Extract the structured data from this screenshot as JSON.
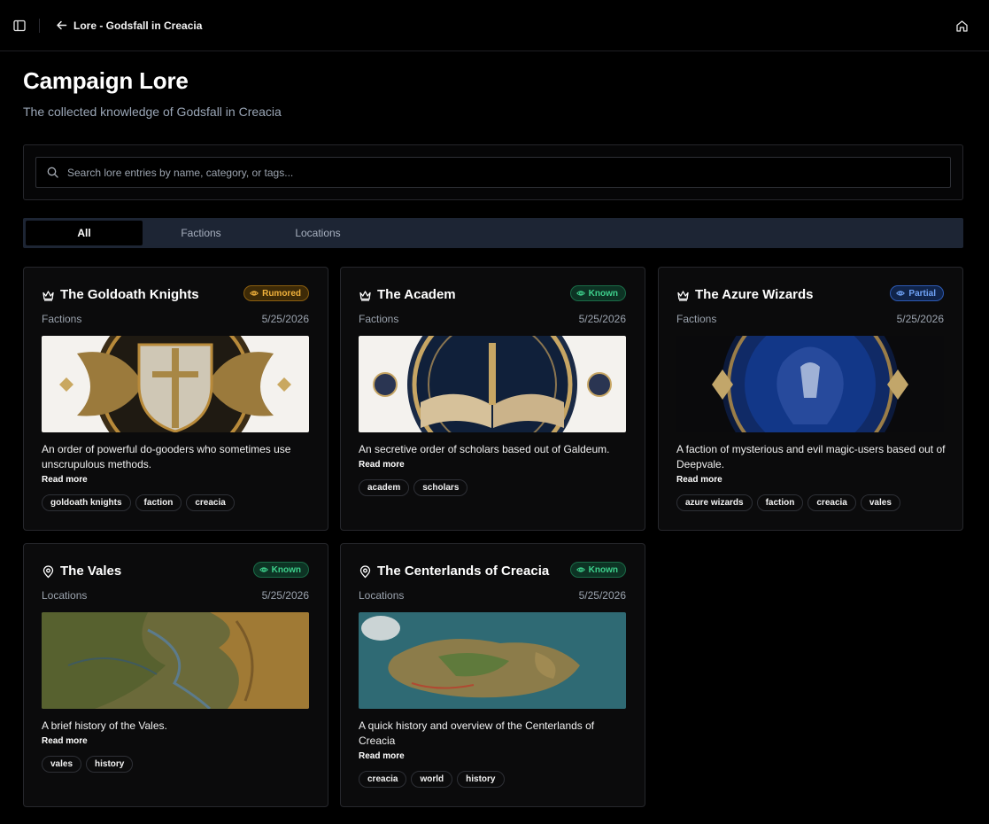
{
  "topbar": {
    "breadcrumb": "Lore - Godsfall in Creacia"
  },
  "header": {
    "title": "Campaign Lore",
    "subtitle": "The collected knowledge of Godsfall in Creacia"
  },
  "search": {
    "placeholder": "Search lore entries by name, category, or tags..."
  },
  "tabs": [
    {
      "label": "All",
      "active": true
    },
    {
      "label": "Factions",
      "active": false
    },
    {
      "label": "Locations",
      "active": false
    }
  ],
  "read_more_label": "Read more",
  "cards": [
    {
      "title": "The Goldoath Knights",
      "badge": "Rumored",
      "category": "Factions",
      "date": "5/25/2026",
      "description": "An order of powerful do-gooders who sometimes use unscrupulous methods.",
      "tags": [
        "goldoath knights",
        "faction",
        "creacia"
      ]
    },
    {
      "title": "The Academ",
      "badge": "Known",
      "category": "Factions",
      "date": "5/25/2026",
      "description": "An secretive order of scholars based out of Galdeum.",
      "tags": [
        "academ",
        "scholars"
      ]
    },
    {
      "title": "The Azure Wizards",
      "badge": "Partial",
      "category": "Factions",
      "date": "5/25/2026",
      "description": "A faction of mysterious and evil magic-users based out of Deepvale.",
      "tags": [
        "azure wizards",
        "faction",
        "creacia",
        "vales"
      ]
    },
    {
      "title": "The Vales",
      "badge": "Known",
      "category": "Locations",
      "date": "5/25/2026",
      "description": "A brief history of the Vales.",
      "tags": [
        "vales",
        "history"
      ]
    },
    {
      "title": "The Centerlands of Creacia",
      "badge": "Known",
      "category": "Locations",
      "date": "5/25/2026",
      "description": "A quick history and overview of the Centerlands of Creacia",
      "tags": [
        "creacia",
        "world",
        "history"
      ]
    }
  ]
}
